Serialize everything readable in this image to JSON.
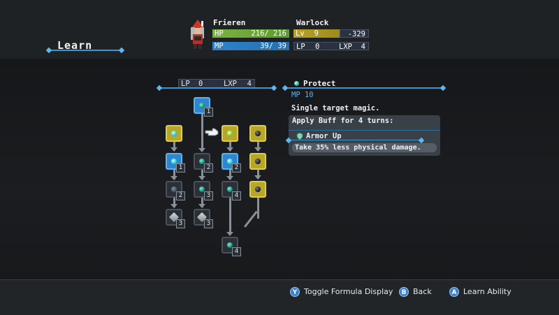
{
  "header": {
    "title": "Learn",
    "character": {
      "name": "Frieren",
      "job": "Warlock",
      "hp_label": "HP",
      "hp_value": "216/ 216",
      "mp_label": "MP",
      "mp_value": "39/ 39",
      "lv_label": "Lv",
      "lv_value": "9",
      "lv_next": "-329",
      "lp_label": "LP",
      "lp_value": "0",
      "lxp_label": "LXP",
      "lxp_value": "4"
    }
  },
  "tree_panel": {
    "lp_label": "LP",
    "lp_value": "0",
    "lxp_label": "LXP",
    "lxp_value": "4",
    "nodes": [
      {
        "id": "top",
        "badge": "1"
      },
      {
        "id": "c1r1",
        "badge": ""
      },
      {
        "id": "c1r2",
        "badge": "1"
      },
      {
        "id": "c1r3",
        "badge": "2"
      },
      {
        "id": "c1r4",
        "badge": "3"
      },
      {
        "id": "c2r2",
        "badge": "2"
      },
      {
        "id": "c2r3",
        "badge": "3"
      },
      {
        "id": "c2r4",
        "badge": "3"
      },
      {
        "id": "c3r1",
        "badge": ""
      },
      {
        "id": "c3r2",
        "badge": "2"
      },
      {
        "id": "c3r3",
        "badge": "4"
      },
      {
        "id": "c4r1",
        "badge": ""
      },
      {
        "id": "c4r2",
        "badge": ""
      },
      {
        "id": "c4r3",
        "badge": ""
      },
      {
        "id": "bottom",
        "badge": "4"
      }
    ]
  },
  "skill": {
    "name": "Protect",
    "mp_cost": "MP 10",
    "target": "Single target magic.",
    "buff_heading": "Apply Buff for 4 turns:",
    "buff_name": "Armor Up",
    "buff_desc": "Take 35% less physical damage."
  },
  "footer": {
    "hints": [
      {
        "button": "Y",
        "label": "Toggle Formula Display"
      },
      {
        "button": "B",
        "label": "Back"
      },
      {
        "button": "A",
        "label": "Learn Ability"
      }
    ]
  },
  "colors": {
    "accent": "#3b95cf",
    "hp": "#7bb342",
    "mp": "#2f83c9",
    "lv": "#b8a229"
  }
}
